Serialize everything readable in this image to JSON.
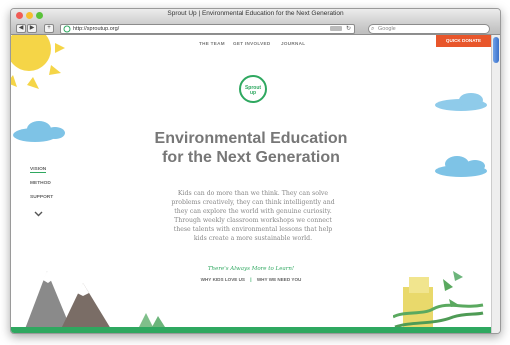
{
  "browser": {
    "title": "Sprout Up | Environmental Education for the Next Generation",
    "url": "http://sproutup.org/",
    "search_placeholder": "Google",
    "back_icon": "◀",
    "forward_icon": "▶",
    "add_icon": "+"
  },
  "header": {
    "nav": [
      "THE TEAM",
      "GET INVOLVED",
      "JOURNAL"
    ],
    "donate": "QUICK DONATE"
  },
  "logo": {
    "line1": "Sprout",
    "line2": "up"
  },
  "hero": {
    "headline_line1": "Environmental Education",
    "headline_line2": "for the Next Generation",
    "paragraph": "Kids can do more than we think. They can solve problems creatively, they can think intelligently and they can explore the world with genuine curiosity. Through weekly classroom workshops we connect these talents with environmental lessons that help kids create a more sustainable world.",
    "tagline": "There's Always More to Learn!",
    "link1": "WHY KIDS LOVE US",
    "separator": "|",
    "link2": "WHY WE NEED YOU"
  },
  "sidenav": {
    "items": [
      "VISION",
      "METHOD",
      "SUPPORT"
    ],
    "more_icon": "chevron-down-icon"
  },
  "colors": {
    "green": "#2fa860",
    "orange": "#e8562b",
    "gray_text": "#777777",
    "sky_blue": "#7ec3e6",
    "sun_yellow": "#f5d547"
  }
}
